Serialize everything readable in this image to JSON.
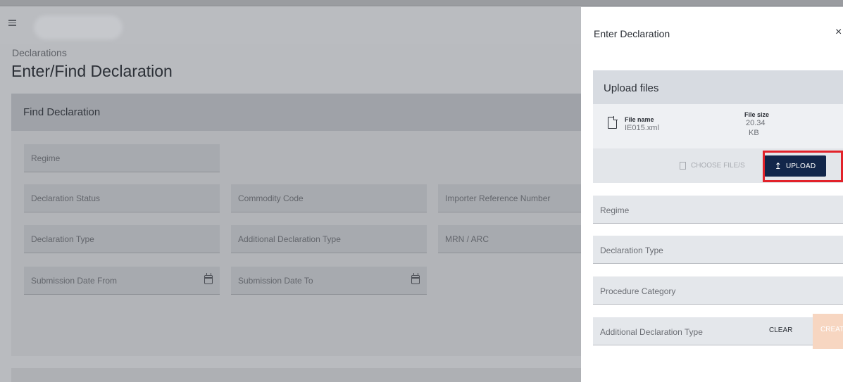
{
  "page": {
    "breadcrumb": "Declarations",
    "title": "Enter/Find Declaration"
  },
  "find_panel": {
    "title": "Find Declaration",
    "fields": {
      "regime": "Regime",
      "declaration_status": "Declaration Status",
      "commodity_code": "Commodity Code",
      "importer_reference_number": "Importer Reference Number",
      "declaration_type": "Declaration Type",
      "additional_declaration_type": "Additional Declaration Type",
      "mrn_arc": "MRN / ARC",
      "submission_date_from": "Submission Date From",
      "submission_date_to": "Submission Date To"
    }
  },
  "dialog": {
    "title": "Enter Declaration",
    "close_glyph": "×",
    "upload": {
      "title": "Upload files",
      "file_name_header": "File name",
      "file_name": "IE015.xml",
      "file_size_header": "File size",
      "file_size_value": "20.34",
      "file_size_unit": "KB",
      "choose_label": "CHOOSE FILE/S",
      "upload_label": "UPLOAD",
      "upload_icon": "↥"
    },
    "fields": {
      "regime": "Regime",
      "declaration_type": "Declaration Type",
      "procedure_category": "Procedure Category",
      "additional_declaration_type": "Additional Declaration Type"
    },
    "actions": {
      "clear": "CLEAR",
      "create": "CREATE"
    }
  },
  "colors": {
    "upload_button": "#12264a",
    "highlight_border": "#e2222a",
    "create_button": "#f7d6c1"
  }
}
